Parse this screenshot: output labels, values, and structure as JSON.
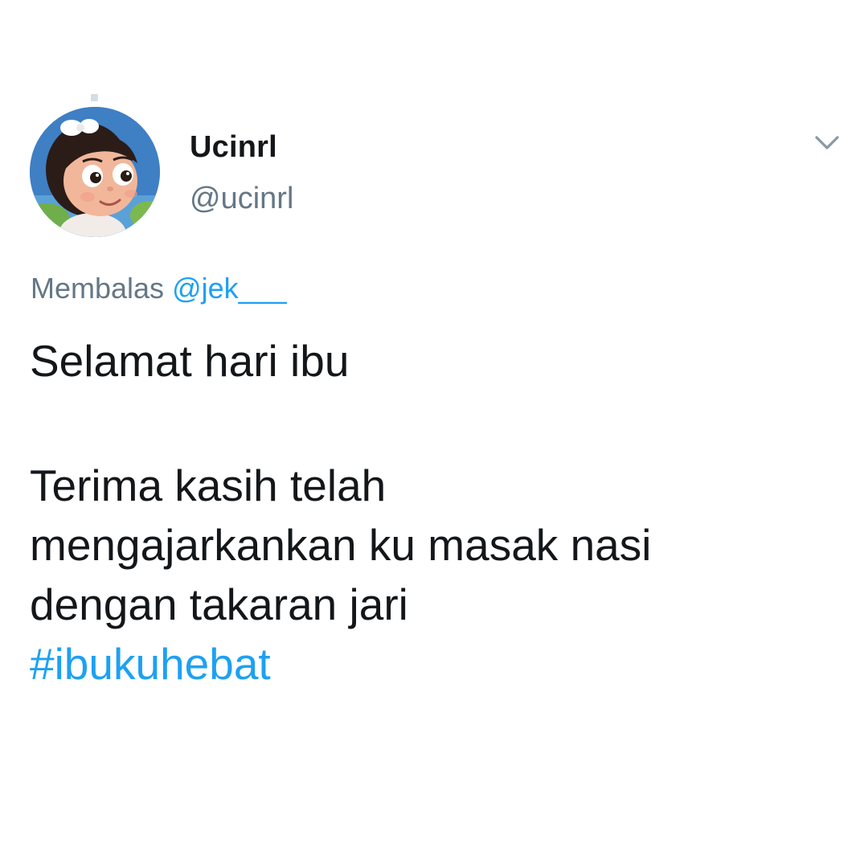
{
  "tweet": {
    "author": {
      "display_name": "Ucinrl",
      "handle": "@ucinrl",
      "avatar_icon": "cartoon-girl-avatar"
    },
    "menu_icon": "chevron-down-icon",
    "reply": {
      "prefix": "Membalas",
      "mention": "@jek___"
    },
    "text": {
      "line1": "Selamat hari ibu",
      "line2": "Terima kasih telah",
      "line3": "mengajarkankan ku masak nasi",
      "line4": "dengan takaran jari",
      "hashtag": "#ibukuhebat"
    },
    "colors": {
      "link": "#1da1f2",
      "secondary_text": "#657786",
      "primary_text": "#14171a"
    }
  }
}
